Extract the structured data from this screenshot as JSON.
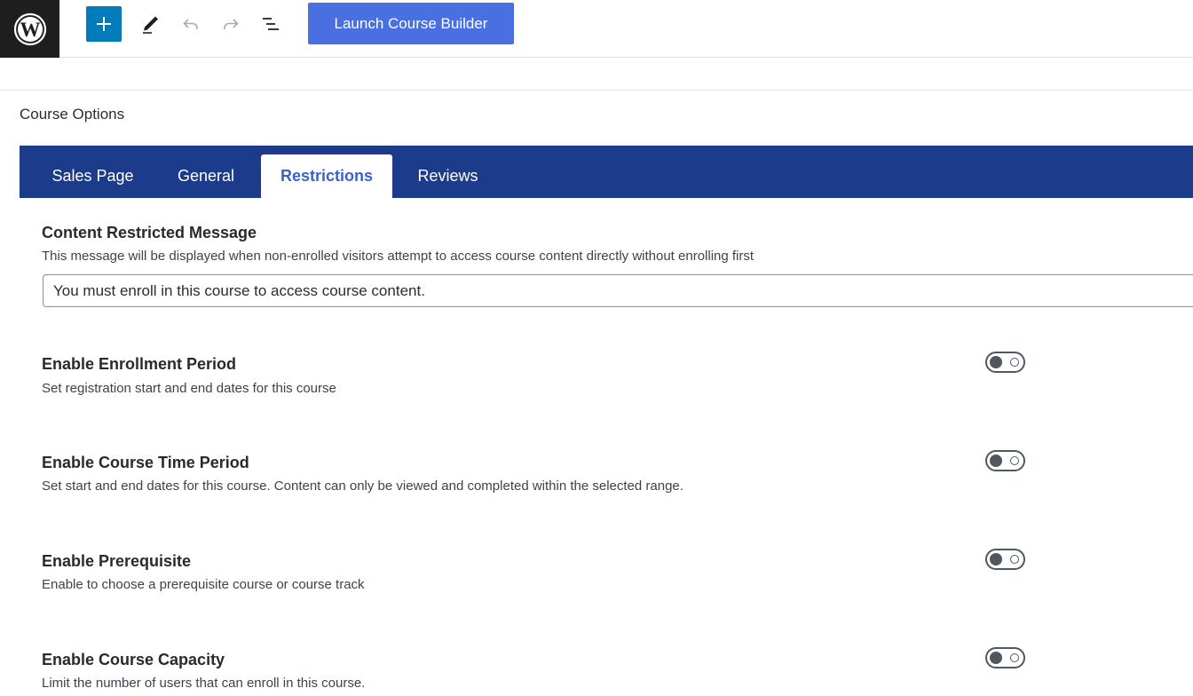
{
  "toolbar": {
    "launch_label": "Launch Course Builder"
  },
  "panel": {
    "title": "Course Options"
  },
  "tabs": [
    {
      "label": "Sales Page",
      "active": false
    },
    {
      "label": "General",
      "active": false
    },
    {
      "label": "Restrictions",
      "active": true
    },
    {
      "label": "Reviews",
      "active": false
    }
  ],
  "restrictions": {
    "message": {
      "heading": "Content Restricted Message",
      "description": "This message will be displayed when non-enrolled visitors attempt to access course content directly without enrolling first",
      "value": "You must enroll in this course to access course content."
    },
    "options": [
      {
        "heading": "Enable Enrollment Period",
        "description": "Set registration start and end dates for this course",
        "enabled": false
      },
      {
        "heading": "Enable Course Time Period",
        "description": "Set start and end dates for this course. Content can only be viewed and completed within the selected range.",
        "enabled": false
      },
      {
        "heading": "Enable Prerequisite",
        "description": "Enable to choose a prerequisite course or course track",
        "enabled": false
      },
      {
        "heading": "Enable Course Capacity",
        "description": "Limit the number of users that can enroll in this course.",
        "enabled": false
      }
    ]
  },
  "colors": {
    "tab_bar": "#1c3b8a",
    "active_tab_text": "#3a62c9",
    "launch_button": "#4a6fe0",
    "add_button": "#007cba"
  }
}
